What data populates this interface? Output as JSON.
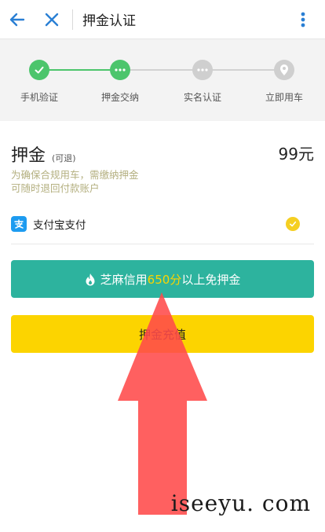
{
  "header": {
    "title": "押金认证"
  },
  "steps": [
    {
      "label": "手机验证",
      "state": "done"
    },
    {
      "label": "押金交纳",
      "state": "active"
    },
    {
      "label": "实名认证",
      "state": "pending"
    },
    {
      "label": "立即用车",
      "state": "pending"
    }
  ],
  "colors": {
    "green": "#4cc56c",
    "teal": "#2db39e",
    "yellow": "#fcd400",
    "gray": "#cfcfcf",
    "arrow": "#ff4a4a"
  },
  "deposit": {
    "title": "押金",
    "refundable": "(可退)",
    "amount": "99元",
    "note_line1": "为确保合规用车，需缴纳押金",
    "note_line2": "可随时退回付款账户"
  },
  "payment": {
    "method": "支付宝支付",
    "icon": "alipay-icon",
    "selected": true
  },
  "sesame_button": {
    "prefix": "芝麻信用",
    "score": "650分",
    "suffix": "以上免押金",
    "icon": "flame-icon"
  },
  "recharge_button": {
    "label": "押金充值"
  },
  "watermark": "iseeyu. com"
}
